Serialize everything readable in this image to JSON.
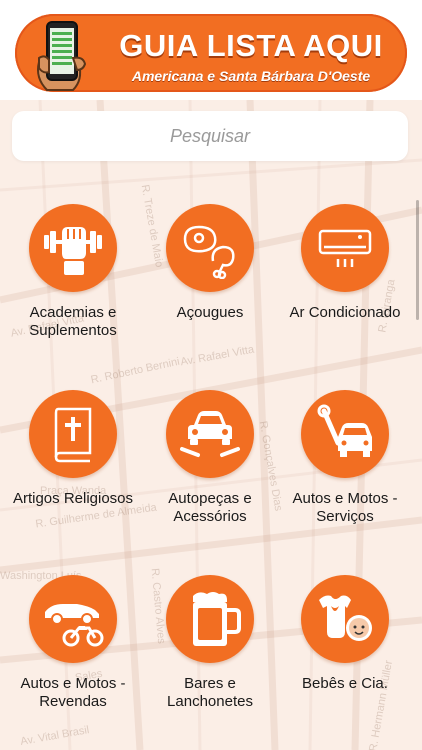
{
  "colors": {
    "accent": "#f26e22",
    "accent_dark": "#e4571a",
    "background": "#fbeee6"
  },
  "header": {
    "title": "GUIA LISTA AQUI",
    "subtitle": "Americana e Santa Bárbara D'Oeste",
    "logo_icon": "phone-in-hand-icon"
  },
  "search": {
    "placeholder": "Pesquisar"
  },
  "map_labels": [
    "R. Treze de Maio",
    "Av. Rafael Vitta",
    "R. Roberto Bernini",
    "Praça Wanda",
    "R. Gonçalves Dias",
    "Washington Luís",
    "Av. Rafael Vitta",
    "R. Castro Alves",
    "R. Guilherme de Almeida",
    "Av. Vital Brasil",
    "R. Hermann Müller",
    "R. Ipiranga",
    "Sales"
  ],
  "categories": [
    {
      "label": "Academias e Suplementos",
      "icon": "fitness-fist-dumbbell-icon"
    },
    {
      "label": "Açougues",
      "icon": "meat-steak-icon"
    },
    {
      "label": "Ar Condicionado",
      "icon": "air-conditioner-icon"
    },
    {
      "label": "Artigos Religiosos",
      "icon": "bible-icon"
    },
    {
      "label": "Autopeças e Acessórios",
      "icon": "car-wrench-icon"
    },
    {
      "label": "Autos e Motos - Serviços",
      "icon": "car-service-wrench-icon"
    },
    {
      "label": "Autos e Motos - Revendas",
      "icon": "car-motorcycle-icon"
    },
    {
      "label": "Bares e Lanchonetes",
      "icon": "beer-mug-icon"
    },
    {
      "label": "Bebês e Cia.",
      "icon": "baby-onesie-icon"
    }
  ]
}
